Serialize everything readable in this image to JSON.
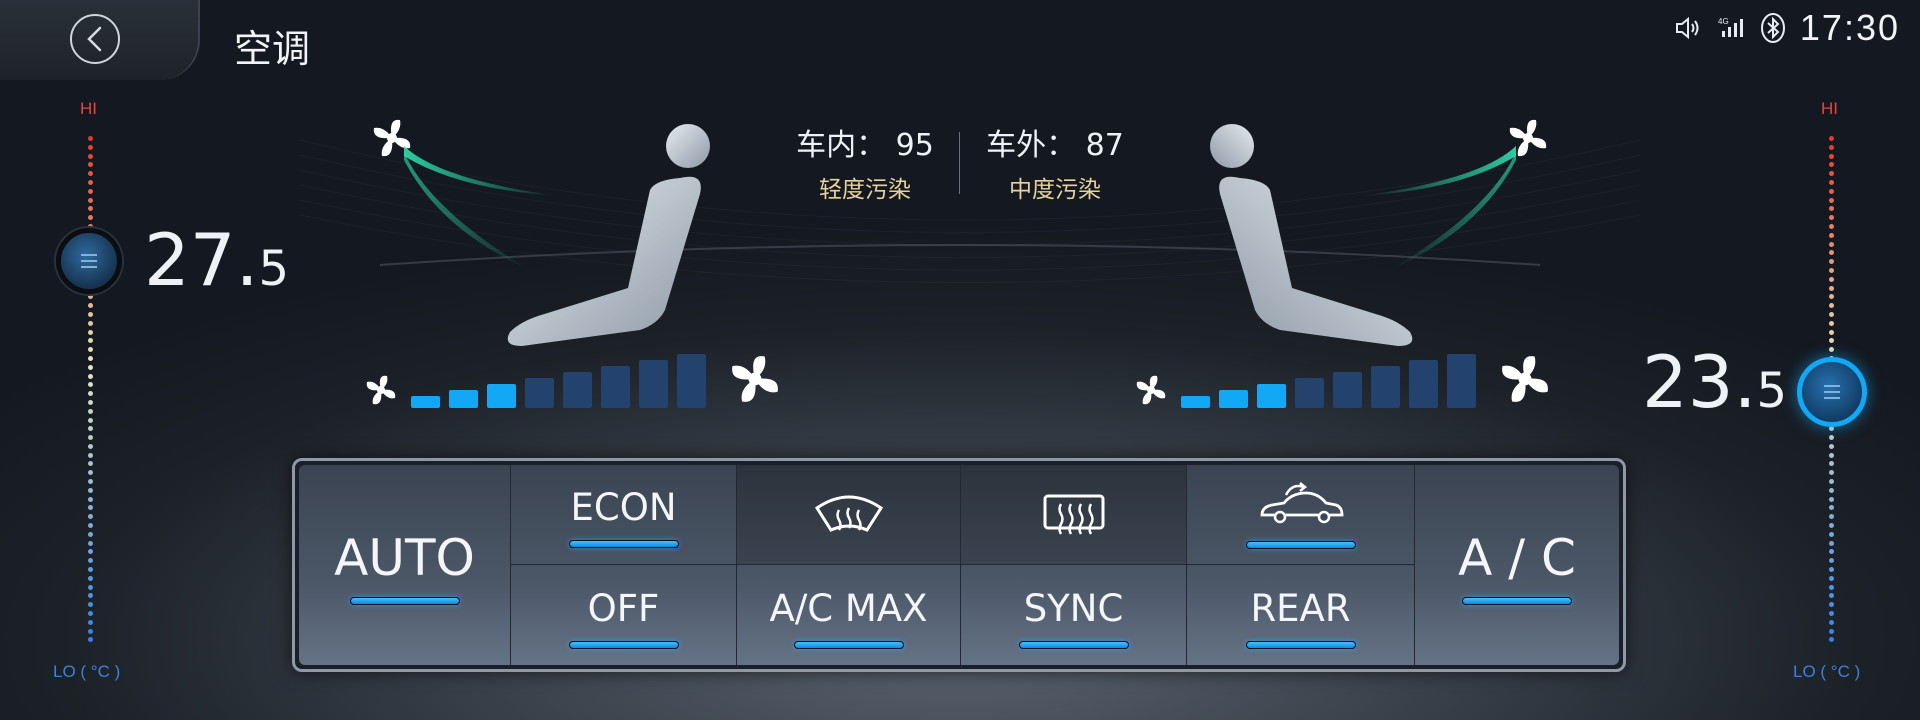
{
  "header": {
    "title": "空调",
    "clock": "17:30",
    "status_icons": [
      "volume-icon",
      "signal-icon",
      "bluetooth-icon"
    ]
  },
  "left_zone": {
    "hi_label": "HI",
    "lo_label": "LO ( °C )",
    "temp_int": "27.",
    "temp_dec": "5",
    "fan_level": 3,
    "fan_max": 8
  },
  "right_zone": {
    "hi_label": "HI",
    "lo_label": "LO ( °C )",
    "temp_int": "23.",
    "temp_dec": "5",
    "fan_level": 3,
    "fan_max": 8
  },
  "air_quality": {
    "inside_label": "车内：",
    "inside_value": "95",
    "inside_status": "轻度污染",
    "outside_label": "车外：",
    "outside_value": "87",
    "outside_status": "中度污染"
  },
  "controls": {
    "auto": "AUTO",
    "econ": "ECON",
    "off": "OFF",
    "ac_max": "A/C MAX",
    "sync": "SYNC",
    "rear": "REAR",
    "ac": "A / C",
    "front_defrost_icon": "front-defrost-icon",
    "rear_defrost_icon": "rear-defrost-icon",
    "recirculation_icon": "recirculation-icon"
  },
  "colors": {
    "accent": "#13a8f5",
    "hi": "#e6453a",
    "lo": "#3b82d8",
    "aq_status": "#e7d29c"
  }
}
